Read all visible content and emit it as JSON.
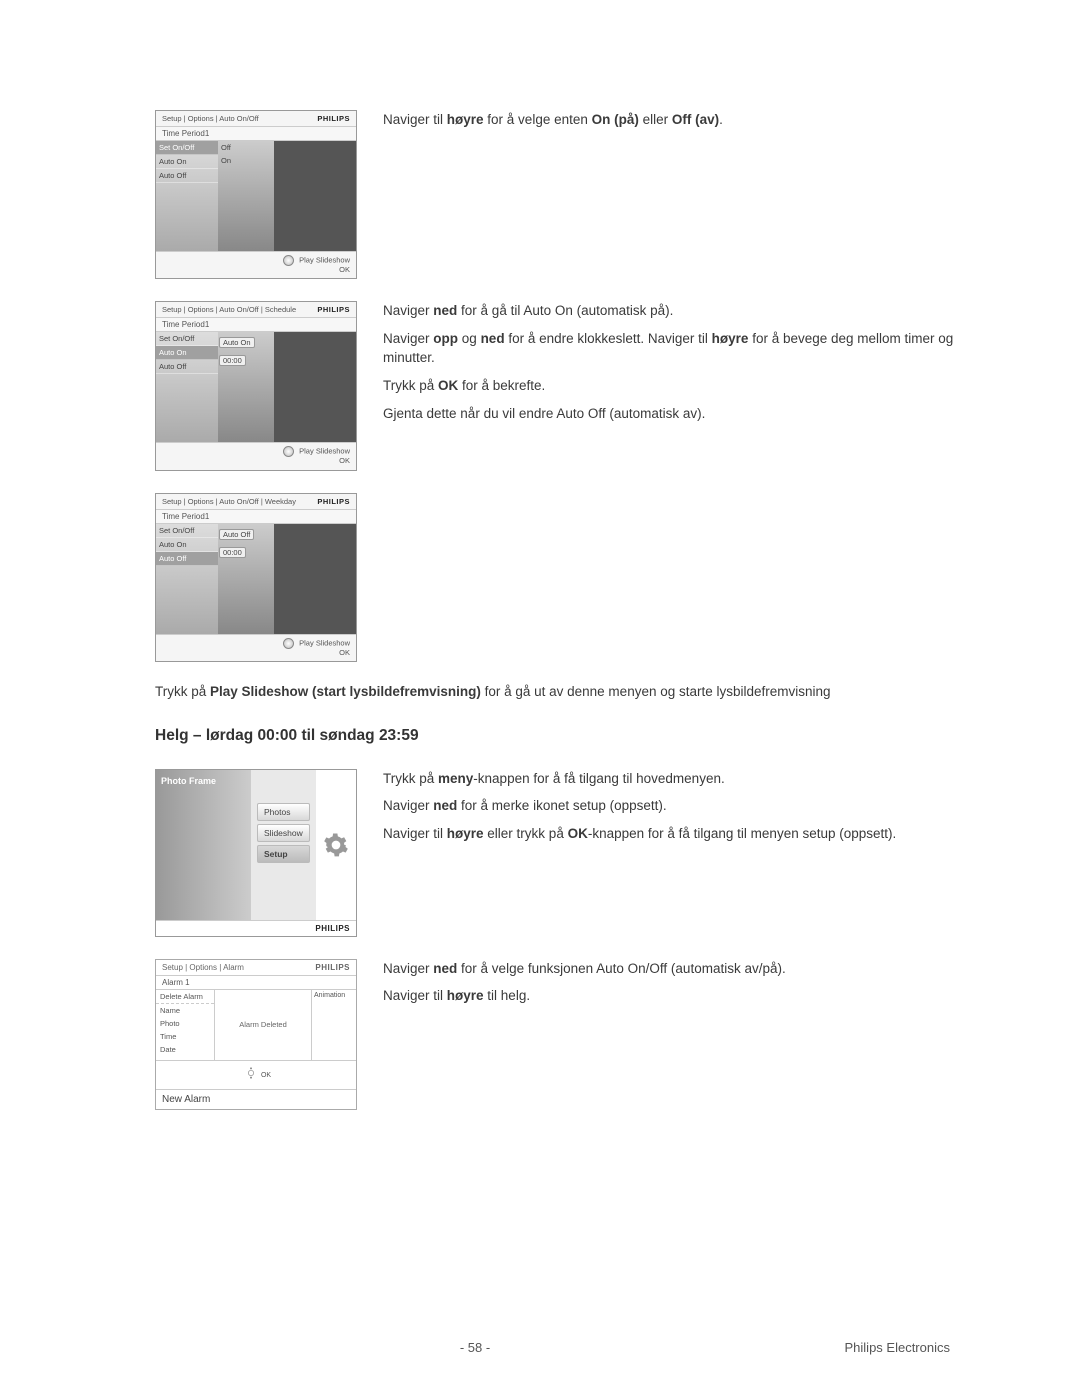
{
  "brand": "PHILIPS",
  "shot1": {
    "breadcrumb": "Setup | Options | Auto On/Off",
    "period": "Time Period1",
    "leftItems": [
      "Set On/Off",
      "Auto On",
      "Auto Off"
    ],
    "midItems": [
      "Off",
      "On"
    ],
    "footer1": "Play Slideshow",
    "footer2": "OK"
  },
  "text1": {
    "p1a": "Naviger til ",
    "p1b": "høyre",
    "p1c": " for å velge enten ",
    "p1d": "On (på)",
    "p1e": " eller ",
    "p1f": "Off (av)",
    "p1g": "."
  },
  "shot2": {
    "breadcrumb": "Setup | Options | Auto On/Off | Schedule",
    "period": "Time Period1",
    "leftItems": [
      "Set On/Off",
      "Auto On",
      "Auto Off"
    ],
    "pillA": "Auto On",
    "pillB": "00:00",
    "footer1": "Play Slideshow",
    "footer2": "OK"
  },
  "text2": {
    "p1a": "Naviger ",
    "p1b": "ned",
    "p1c": " for å gå til Auto On (automatisk på).",
    "p2a": "Naviger ",
    "p2b": "opp",
    "p2c": " og ",
    "p2d": "ned",
    "p2e": " for å endre klokkeslett. Naviger til ",
    "p2f": "høyre",
    "p2g": " for å bevege deg mellom timer og minutter.",
    "p3a": "Trykk på ",
    "p3b": "OK",
    "p3c": " for å bekrefte.",
    "p4": "Gjenta dette når du vil endre Auto Off (automatisk av)."
  },
  "shot3": {
    "breadcrumb": "Setup | Options | Auto On/Off | Weekday",
    "period": "Time Period1",
    "leftItems": [
      "Set On/Off",
      "Auto On",
      "Auto Off"
    ],
    "pillA": "Auto Off",
    "pillB": "00:00",
    "footer1": "Play Slideshow",
    "footer2": "OK"
  },
  "slideshow": {
    "a": "Trykk på ",
    "b": "Play Slideshow (start lysbildefremvisning)",
    "c": " for å gå ut av denne menyen og starte lysbildefremvisning"
  },
  "heading": "Helg – lørdag 00:00 til søndag 23:59",
  "mainmenu": {
    "title": "Photo Frame",
    "items": [
      "Photos",
      "Slideshow",
      "Setup"
    ]
  },
  "text3": {
    "p1a": "Trykk på ",
    "p1b": "meny",
    "p1c": "-knappen for å få tilgang til hovedmenyen.",
    "p2a": "Naviger ",
    "p2b": "ned",
    "p2c": " for å merke ikonet setup (oppsett).",
    "p3a": "Naviger til ",
    "p3b": "høyre",
    "p3c": " eller trykk på ",
    "p3d": "OK",
    "p3e": "-knappen for å få tilgang til menyen setup (oppsett)."
  },
  "alarm": {
    "breadcrumb": "Setup | Options | Alarm",
    "sub": "Alarm 1",
    "left": [
      "Delete Alarm",
      "Name",
      "Photo",
      "Time",
      "Date"
    ],
    "mid": "Alarm Deleted",
    "right": "Animation",
    "ok": "OK",
    "bottom": "New Alarm"
  },
  "text4": {
    "p1a": "Naviger ",
    "p1b": "ned",
    "p1c": " for å velge funksjonen Auto On/Off (automatisk av/på).",
    "p2a": "Naviger til ",
    "p2b": "høyre",
    "p2c": " til helg."
  },
  "footer": {
    "page": "- 58 -",
    "publisher": "Philips Electronics"
  }
}
